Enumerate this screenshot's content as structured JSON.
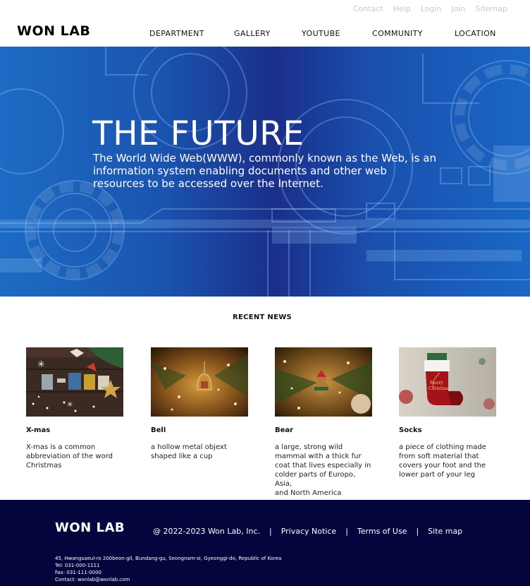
{
  "util_links": [
    "Contact",
    "Help",
    "Login",
    "Join",
    "Sitemap"
  ],
  "header": {
    "logo": "WON LAB",
    "nav": [
      "DEPARTMENT",
      "GALLERY",
      "YOUTUBE",
      "COMMUNITY",
      "LOCATION"
    ]
  },
  "hero": {
    "title": "THE FUTURE",
    "text": "The World Wide Web(WWW), commonly known as the Web, is an information system enabling documents and other web resources to be accessed over the Internet."
  },
  "news": {
    "heading": "RECENT NEWS",
    "items": [
      {
        "title": "X-mas",
        "text": "X-mas is a common abbreviation of the word Christmas",
        "image": "xmas-letters-image"
      },
      {
        "title": "Bell",
        "text": "a hollow metal objext shaped like a cup",
        "image": "bell-ornament-image"
      },
      {
        "title": "Bear",
        "text": "a large, strong wild mammal with a thick fur coat that lives especially in\ncolder parts of Europo, Asia,\nand North America",
        "image": "bear-ornament-image"
      },
      {
        "title": "Socks",
        "text": "a piece of clothing made from soft material that covers your foot and the lower part of your leg",
        "image": "christmas-stocking-image"
      }
    ]
  },
  "footer": {
    "logo": "WON LAB",
    "copyright": "@ 2022-2023 Won Lab, Inc.",
    "links": [
      "Privacy Notice",
      "Terms of Use",
      "Site map"
    ],
    "address": "45, Hwangsaeul-ro 200beon-gil, Bundang-gu, Seongnam-si, Gyeonggi-do, Republic of Korea",
    "tel": "Tel: 031-000-1111",
    "fax": "Fax: 031-111-0000",
    "contact": "Contact: wonlab@wonlab.com"
  },
  "colors": {
    "hero_blue": "#1a55b0",
    "footer_navy": "#05053d",
    "util_gray": "#c8c8c8"
  }
}
